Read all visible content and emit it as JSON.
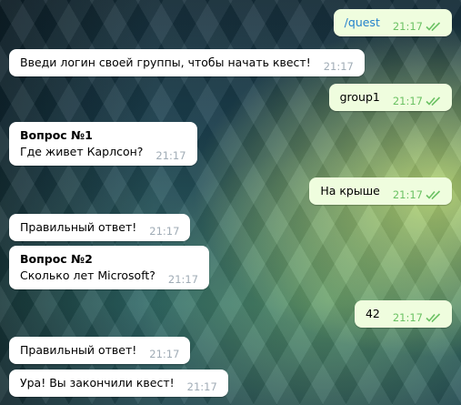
{
  "messages": [
    {
      "dir": "out",
      "text": "/quest",
      "time": "21:17",
      "link": true
    },
    {
      "dir": "in",
      "text": "Введи логин своей группы, чтобы начать квест!",
      "time": "21:17"
    },
    {
      "dir": "out",
      "text": "group1",
      "time": "21:17"
    },
    {
      "dir": "in",
      "title": "Вопрос №1",
      "text": "Где живет Карлсон?",
      "time": "21:17"
    },
    {
      "dir": "out",
      "text": "На крыше",
      "time": "21:17"
    },
    {
      "dir": "in",
      "text": "Правильный ответ!",
      "time": "21:17"
    },
    {
      "dir": "in",
      "title": "Вопрос №2",
      "text": "Сколько лет Microsoft?",
      "time": "21:17"
    },
    {
      "dir": "out",
      "text": "42",
      "time": "21:17"
    },
    {
      "dir": "in",
      "text": "Правильный ответ!",
      "time": "21:17"
    },
    {
      "dir": "in",
      "text": "Ура! Вы закончили квест!",
      "time": "21:17"
    }
  ],
  "colors": {
    "incoming_bubble": "#ffffff",
    "outgoing_bubble": "#effdde",
    "link": "#2481cc",
    "outgoing_time": "#6cc264",
    "incoming_time": "#a0acb6"
  },
  "icons": {
    "read_status": "double-check-icon"
  }
}
